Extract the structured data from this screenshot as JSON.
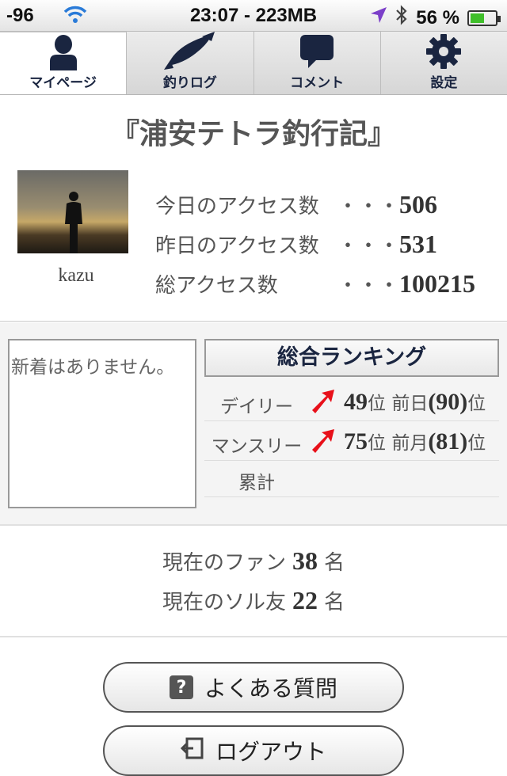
{
  "status_bar": {
    "signal": "-96",
    "center": "23:07 - 223MB",
    "battery": "56 %",
    "battery_level": 0.56
  },
  "tabs": [
    {
      "label": "マイページ",
      "icon": "person-icon",
      "active": true
    },
    {
      "label": "釣りログ",
      "icon": "fish-icon",
      "active": false
    },
    {
      "label": "コメント",
      "icon": "speech-bubble-icon",
      "active": false
    },
    {
      "label": "設定",
      "icon": "gear-icon",
      "active": false
    }
  ],
  "blog_title": "『浦安テトラ釣行記』",
  "profile": {
    "username": "kazu"
  },
  "access": [
    {
      "label": "今日のアクセス数",
      "dots": "・・・",
      "value": "506"
    },
    {
      "label": "昨日のアクセス数",
      "dots": "・・・",
      "value": "531"
    },
    {
      "label": "総アクセス数",
      "dots": "・・・",
      "value": "100215"
    }
  ],
  "news": {
    "empty_text": "新着はありません。"
  },
  "ranking": {
    "header": "総合ランキング",
    "rows": [
      {
        "label": "デイリー",
        "trend": "up-arrow-icon",
        "rank": "49",
        "rank_unit": "位",
        "prev_label": "前日",
        "prev": "(90)",
        "prev_unit": "位"
      },
      {
        "label": "マンスリー",
        "trend": "up-arrow-icon",
        "rank": "75",
        "rank_unit": "位",
        "prev_label": "前月",
        "prev": "(81)",
        "prev_unit": "位"
      },
      {
        "label": "累計"
      }
    ]
  },
  "fans": {
    "fan_prefix": "現在のファン",
    "fan_count": "38",
    "fan_suffix": "名",
    "sol_prefix": "現在のソル友",
    "sol_count": "22",
    "sol_suffix": "名"
  },
  "buttons": {
    "faq": {
      "label": "よくある質問",
      "icon": "question-icon"
    },
    "logout": {
      "label": "ログアウト",
      "icon": "logout-icon"
    }
  },
  "colors": {
    "accent": "#1a2540",
    "arrow": "#e8101a",
    "battery": "#3fbf2a"
  }
}
